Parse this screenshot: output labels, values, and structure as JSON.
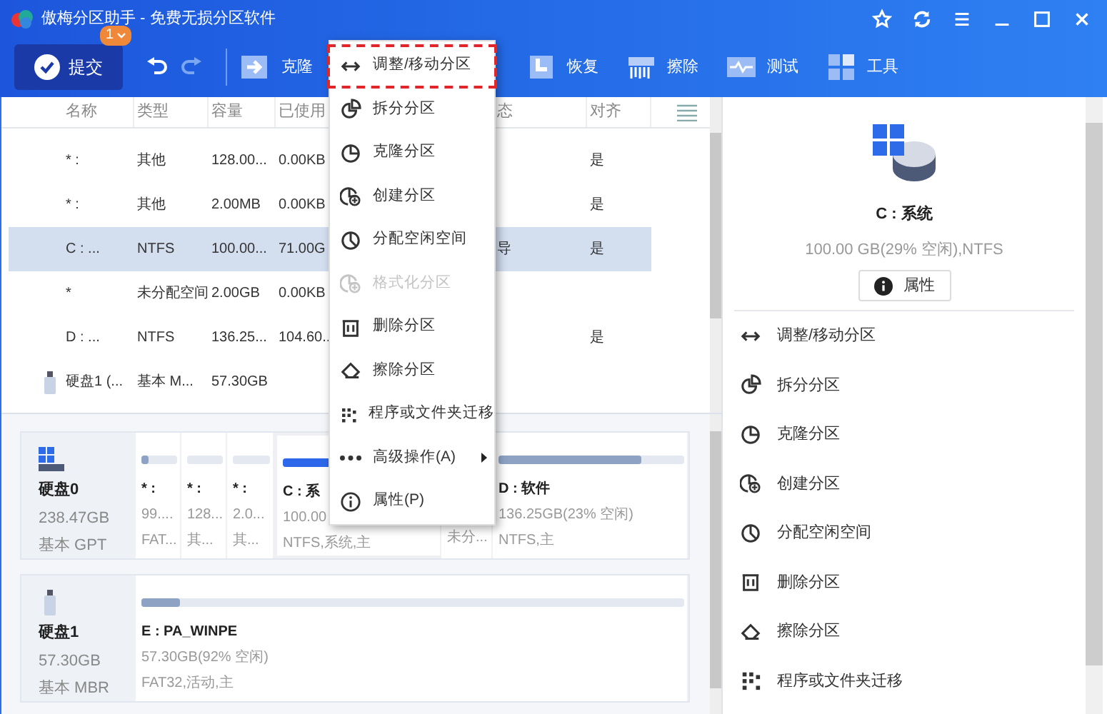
{
  "window": {
    "title": "傲梅分区助手 - 免费无损分区软件"
  },
  "toolbar": {
    "commit": {
      "label": "提交",
      "badge": "1"
    },
    "items": [
      {
        "label": "克隆",
        "kind": "clone"
      },
      {
        "label": "恢复",
        "kind": "restore"
      },
      {
        "label": "擦除",
        "kind": "wipe"
      },
      {
        "label": "测试",
        "kind": "test"
      },
      {
        "label": "工具",
        "kind": "tools"
      }
    ]
  },
  "table": {
    "columns": {
      "name": "名称",
      "type": "类型",
      "capacity": "容量",
      "used": "已使用",
      "column_5": "态",
      "align": "对齐"
    },
    "rows": [
      {
        "kind": "partition",
        "selected": false,
        "name": "* :",
        "type": "其他",
        "capacity": "128.00...",
        "used": "0.00KB",
        "align": "是"
      },
      {
        "kind": "partition",
        "selected": false,
        "name": "* :",
        "type": "其他",
        "capacity": "2.00MB",
        "used": "0.00KB",
        "align": "是"
      },
      {
        "kind": "partition",
        "selected": true,
        "name": "C : ...",
        "type": "NTFS",
        "capacity": "100.00...",
        "used": "71.00G",
        "column_5": "导",
        "align": "是"
      },
      {
        "kind": "partition",
        "selected": false,
        "name": "*",
        "type": "未分配空间",
        "capacity": "2.00GB",
        "used": "0.00KB"
      },
      {
        "kind": "partition",
        "selected": false,
        "name": "D : ...",
        "type": "NTFS",
        "capacity": "136.25...",
        "used": "104.60..",
        "align": "是"
      },
      {
        "kind": "disk",
        "selected": false,
        "name": "硬盘1 (...",
        "type": "基本 M...",
        "capacity": "57.30GB"
      }
    ]
  },
  "disks": [
    {
      "kind": "system",
      "name": "硬盘0",
      "size": "238.47GB",
      "style": "基本 GPT",
      "partitions": [
        {
          "title": "* :",
          "size": "99....",
          "info": "FAT...",
          "level": 0.2,
          "selected": false
        },
        {
          "title": "* :",
          "size": "128...",
          "info": "其...",
          "level": 0,
          "selected": false
        },
        {
          "title": "* :",
          "size": "2.0...",
          "info": "其...",
          "level": 0,
          "selected": false
        },
        {
          "title": "C : 系",
          "size": "100.00",
          "info": "NTFS,系统,主",
          "level": 0.71,
          "selected": true
        },
        {
          "info": "未分...",
          "selected": false
        },
        {
          "title": "D : 软件",
          "size": "136.25GB(23% 空闲)",
          "info": "NTFS,主",
          "level": 0.77,
          "selected": false
        }
      ]
    },
    {
      "kind": "usb",
      "name": "硬盘1",
      "size": "57.30GB",
      "style": "基本 MBR",
      "partitions": [
        {
          "title": "E : PA_WINPE",
          "size": "57.30GB(92% 空闲)",
          "info": "FAT32,活动,主",
          "level": 0.07,
          "selected": false
        }
      ]
    }
  ],
  "context_menu": {
    "items": [
      {
        "label": "调整/移动分区",
        "kind": "resize",
        "disabled": false,
        "highlighted": true
      },
      {
        "label": "拆分分区",
        "kind": "split",
        "disabled": false,
        "highlighted": false
      },
      {
        "label": "克隆分区",
        "kind": "clone",
        "disabled": false,
        "highlighted": false
      },
      {
        "label": "创建分区",
        "kind": "create",
        "disabled": false,
        "highlighted": false
      },
      {
        "label": "分配空闲空间",
        "kind": "allocate",
        "disabled": false,
        "highlighted": false
      },
      {
        "label": "格式化分区",
        "kind": "create",
        "disabled": true,
        "highlighted": false
      },
      {
        "label": "删除分区",
        "kind": "delete",
        "disabled": false,
        "highlighted": false
      },
      {
        "label": "擦除分区",
        "kind": "wipe",
        "disabled": false,
        "highlighted": false
      },
      {
        "label": "程序或文件夹迁移",
        "kind": "migrate",
        "disabled": false,
        "highlighted": false
      },
      {
        "label": "高级操作(A)",
        "kind": "more",
        "disabled": false,
        "highlighted": false
      },
      {
        "label": "属性(P)",
        "kind": "info",
        "disabled": false,
        "highlighted": false
      }
    ]
  },
  "details": {
    "title": "C : 系统",
    "info": "100.00 GB(29% 空闲),NTFS",
    "button": "属性",
    "actions": [
      {
        "label": "调整/移动分区",
        "kind": "resize"
      },
      {
        "label": "拆分分区",
        "kind": "split"
      },
      {
        "label": "克隆分区",
        "kind": "clone"
      },
      {
        "label": "创建分区",
        "kind": "create"
      },
      {
        "label": "分配空闲空间",
        "kind": "allocate"
      },
      {
        "label": "删除分区",
        "kind": "delete"
      },
      {
        "label": "擦除分区",
        "kind": "wipe"
      },
      {
        "label": "程序或文件夹迁移",
        "kind": "migrate"
      }
    ]
  }
}
